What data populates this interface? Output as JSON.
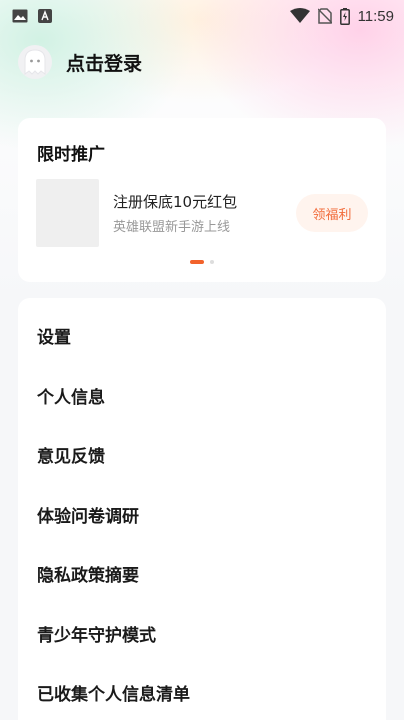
{
  "status_bar": {
    "time": "11:59",
    "icons": [
      "gallery-icon",
      "a-badge-icon",
      "wifi-icon",
      "no-sim-icon",
      "battery-icon"
    ]
  },
  "header": {
    "login_label": "点击登录",
    "avatar_icon": "ghost-avatar-icon"
  },
  "promo": {
    "title": "限时推广",
    "item": {
      "name": "注册保底10元红包",
      "description": "英雄联盟新手游上线",
      "button_label": "领福利"
    },
    "pager": {
      "count": 2,
      "active": 1
    }
  },
  "menu": {
    "items": [
      {
        "label": "设置"
      },
      {
        "label": "个人信息"
      },
      {
        "label": "意见反馈"
      },
      {
        "label": "体验问卷调研"
      },
      {
        "label": "隐私政策摘要"
      },
      {
        "label": "青少年守护模式"
      },
      {
        "label": "已收集个人信息清单"
      }
    ]
  },
  "colors": {
    "accent": "#f2622b",
    "button_bg": "#fff4ee",
    "button_text": "#f26b3a",
    "page_bg": "#f6f7f9"
  }
}
